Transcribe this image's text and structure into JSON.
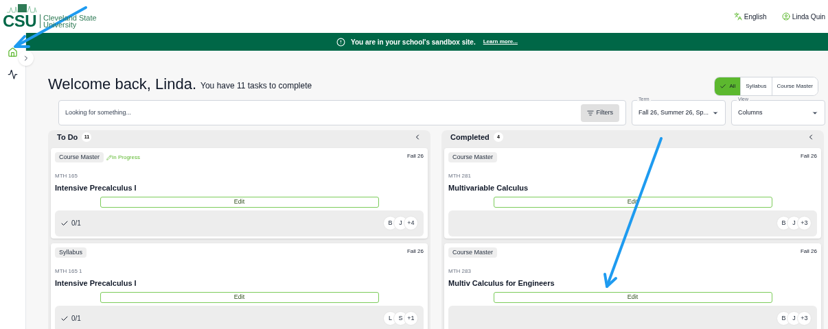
{
  "logo": {
    "mark": "CSU",
    "name": "Cleveland State University"
  },
  "header": {
    "language": "English",
    "user": "Linda Quin"
  },
  "banner": {
    "message": "You are in your school's sandbox site.",
    "link": "Learn more..."
  },
  "sidebar": {
    "items": [
      {
        "kind": "home",
        "selected": true
      },
      {
        "kind": "analytics",
        "selected": false
      }
    ]
  },
  "welcome": {
    "title": "Welcome back, Linda.",
    "subtitle": "You have 11 tasks to complete"
  },
  "view_toggle": [
    {
      "label": "All",
      "selected": true
    },
    {
      "label": "Syllabus",
      "selected": false
    },
    {
      "label": "Course Master",
      "selected": false
    }
  ],
  "search": {
    "placeholder": "Looking for something...",
    "filters": "Filters"
  },
  "term_field": {
    "label": "Term",
    "value": "Fall 26, Summer 26, Sp..."
  },
  "view_field": {
    "label": "View",
    "value": "Columns"
  },
  "columns": [
    {
      "title": "To Do",
      "count": "11",
      "cards": [
        {
          "tag": "Course Master",
          "status": "In Progress",
          "term": "Fall 26",
          "code": "MTH 165",
          "title": "Intensive Precalculus I",
          "action": "Edit",
          "progress": "0/1",
          "avatars": [
            "B",
            "J",
            "+4"
          ]
        },
        {
          "tag": "Syllabus",
          "term": "Fall 26",
          "code": "MTH 165 1",
          "title": "Intensive Precalculus I",
          "action": "Edit",
          "progress": "0/1",
          "avatars": [
            "L",
            "S",
            "+1"
          ]
        }
      ]
    },
    {
      "title": "Completed",
      "count": "4",
      "cards": [
        {
          "tag": "Course Master",
          "term": "Fall 26",
          "code": "MTH 281",
          "title": "Multivariable Calculus",
          "action": "Edit",
          "avatars": [
            "B",
            "J",
            "+3"
          ]
        },
        {
          "tag": "Course Master",
          "term": "Fall 26",
          "code": "MTH 283",
          "title": "Multiv Calculus for Engineers",
          "action": "Edit",
          "avatars": [
            "B",
            "J",
            "+3"
          ]
        }
      ]
    }
  ]
}
